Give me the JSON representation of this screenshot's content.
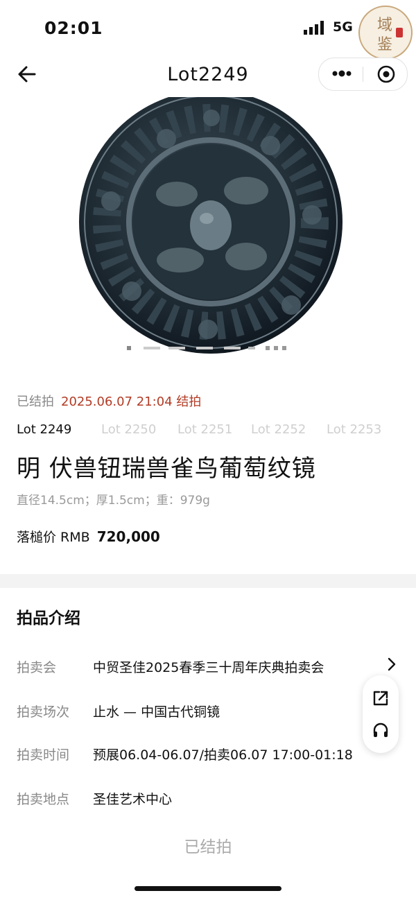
{
  "status_bar": {
    "time": "02:01",
    "network": "5G"
  },
  "watermark": {
    "chars": [
      "域",
      "鉴"
    ]
  },
  "nav": {
    "title": "Lot2249"
  },
  "auction": {
    "sold_label": "已结拍",
    "sold_date": "2025.06.07 21:04 结拍"
  },
  "lot_tabs": [
    "Lot 2249",
    "Lot 2250",
    "Lot 2251",
    "Lot 2252",
    "Lot 2253"
  ],
  "lot": {
    "name": "明 伏兽钮瑞兽雀鸟葡萄纹镜",
    "specs": "直径14.5cm；厚1.5cm；重：979g",
    "price_label": "落槌价 RMB",
    "price_value": "720,000"
  },
  "intro": {
    "title": "拍品介绍",
    "rows": [
      {
        "label": "拍卖会",
        "value": "中贸圣佳2025春季三十周年庆典拍卖会"
      },
      {
        "label": "拍卖场次",
        "value": "止水 — 中国古代铜镜"
      },
      {
        "label": "拍卖时间",
        "value": "预展06.04-06.07/拍卖06.07 17:00-01:18"
      },
      {
        "label": "拍卖地点",
        "value": "圣佳艺术中心"
      }
    ]
  },
  "footer": {
    "button": "已结拍"
  },
  "colors": {
    "accent_red": "#b23b25",
    "mirror_dark": "#1e2a32"
  }
}
